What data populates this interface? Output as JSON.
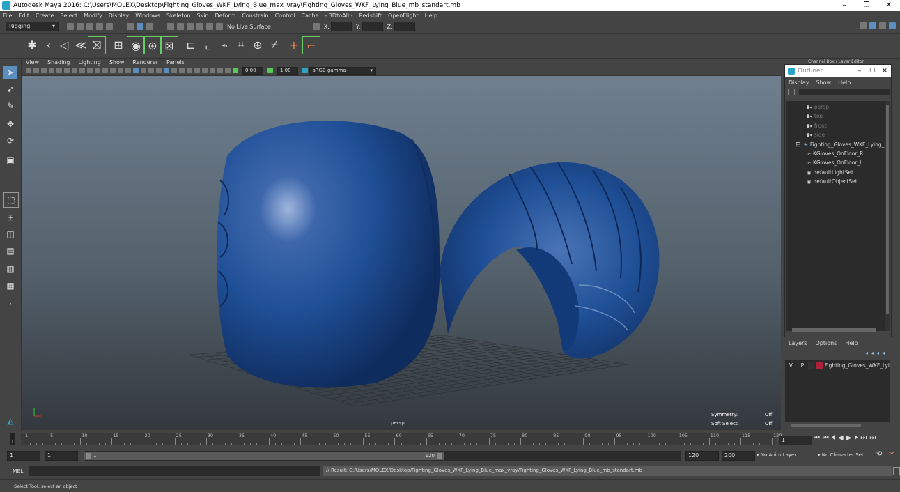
{
  "app": {
    "title": "Autodesk Maya 2016: C:\\Users\\MOLEX\\Desktop\\Fighting_Gloves_WKF_Lying_Blue_max_vray\\Fighting_Gloves_WKF_Lying_Blue_mb_standart.mb",
    "window_buttons": [
      "–",
      "❐",
      "✕"
    ]
  },
  "menubar": [
    "File",
    "Edit",
    "Create",
    "Select",
    "Modify",
    "Display",
    "Windows",
    "Skeleton",
    "Skin",
    "Deform",
    "Constrain",
    "Control",
    "Cache",
    "- 3DtoAll -",
    "Redshift",
    "OpenFlight",
    "Help"
  ],
  "statusline": {
    "menu_set": "Rigging",
    "live_surface": "No Live Surface",
    "x_label": "X:",
    "y_label": "Y:",
    "z_label": "Z:"
  },
  "viewport": {
    "menu": [
      "View",
      "Shading",
      "Lighting",
      "Show",
      "Renderer",
      "Panels"
    ],
    "exposure": "0.00",
    "gamma": "1.00",
    "color_space": "sRGB gamma",
    "camera_label": "persp",
    "hud": {
      "symmetry_label": "Symmetry:",
      "symmetry_value": "Off",
      "soft_select_label": "Soft Select:",
      "soft_select_value": "Off"
    },
    "colors": {
      "glove": "#1f4f96",
      "glove_highlight": "#9fb6de",
      "grid": "#2a2f33"
    }
  },
  "channel_box_title": "Channel Box / Layer Editor",
  "outliner": {
    "title": "Outliner",
    "menu": [
      "Display",
      "Show",
      "Help"
    ],
    "items": [
      {
        "label": "persp",
        "dim": true
      },
      {
        "label": "top",
        "dim": true
      },
      {
        "label": "front",
        "dim": true
      },
      {
        "label": "side",
        "dim": true
      },
      {
        "label": "Fighting_Gloves_WKF_Lying_",
        "dim": false
      },
      {
        "label": "KGloves_OnFloor_R",
        "dim": false
      },
      {
        "label": "KGloves_OnFloor_L",
        "dim": false
      },
      {
        "label": "defaultLightSet",
        "dim": false
      },
      {
        "label": "defaultObjectSet",
        "dim": false
      }
    ]
  },
  "layers": {
    "menu": [
      "Layers",
      "Options",
      "Help"
    ],
    "row": {
      "v": "V",
      "p": "P",
      "name": "Fighting_Gloves_WKF_Lyi",
      "color": "#b0203a"
    }
  },
  "timeline": {
    "ticks": [
      "1",
      "5",
      "10",
      "15",
      "20",
      "25",
      "30",
      "35",
      "40",
      "45",
      "50",
      "55",
      "60",
      "65",
      "70",
      "75",
      "80",
      "85",
      "90",
      "95",
      "100",
      "105",
      "110",
      "115",
      "120"
    ],
    "current_frame": "1"
  },
  "range": {
    "start": "1",
    "playback_start": "1",
    "slider_start": "1",
    "slider_end": "120",
    "playback_end": "120",
    "end": "200",
    "anim_layer": "No Anim Layer",
    "character_set": "No Character Set"
  },
  "command": {
    "lang": "MEL",
    "result": "// Result: C:/Users/MOLEX/Desktop/Fighting_Gloves_WKF_Lying_Blue_max_vray/Fighting_Gloves_WKF_Lying_Blue_mb_standart.mb"
  },
  "help_line": "Select Tool: select an object"
}
